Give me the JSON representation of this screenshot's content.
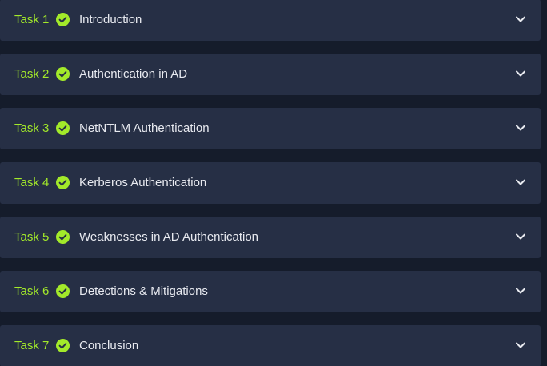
{
  "colors": {
    "page_background": "#151c2b",
    "row_background": "#262f45",
    "task_number": "#a3ea2a",
    "check_fill": "#a3ea2a",
    "title_text": "#e8eaf0",
    "chevron": "#e8eaf0"
  },
  "icons": {
    "status": "check-circle-icon",
    "expand": "chevron-down-icon"
  },
  "tasks": [
    {
      "number": "Task 1",
      "title": "Introduction",
      "completed": true
    },
    {
      "number": "Task 2",
      "title": "Authentication in AD",
      "completed": true
    },
    {
      "number": "Task 3",
      "title": "NetNTLM Authentication",
      "completed": true
    },
    {
      "number": "Task 4",
      "title": "Kerberos Authentication",
      "completed": true
    },
    {
      "number": "Task 5",
      "title": "Weaknesses in AD Authentication",
      "completed": true
    },
    {
      "number": "Task 6",
      "title": "Detections & Mitigations",
      "completed": true
    },
    {
      "number": "Task 7",
      "title": "Conclusion",
      "completed": true
    }
  ]
}
